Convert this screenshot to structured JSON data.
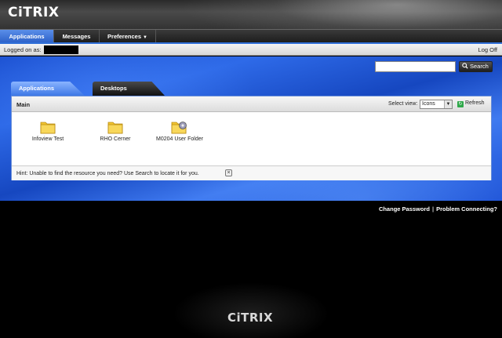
{
  "brand": {
    "logo_text": "CiTRIX"
  },
  "nav": {
    "tabs": [
      {
        "label": "Applications"
      },
      {
        "label": "Messages"
      },
      {
        "label": "Preferences"
      }
    ]
  },
  "session": {
    "logged_on_label": "Logged on as:",
    "logoff_label": "Log Off"
  },
  "search": {
    "placeholder": "",
    "button_label": "Search"
  },
  "content_tabs": {
    "applications": "Applications",
    "desktops": "Desktops"
  },
  "panel": {
    "title": "Main",
    "select_view_label": "Select view:",
    "select_view_value": "Icons",
    "refresh_label": "Refresh",
    "items": [
      {
        "label": "Infoview Test",
        "icon": "folder-icon"
      },
      {
        "label": "RHO Cerner",
        "icon": "folder-icon"
      },
      {
        "label": "M0204 User Folder",
        "icon": "folder-gear-icon"
      }
    ],
    "hint_text": "Hint: Unable to find the resource you need? Use Search to locate it for you."
  },
  "footer": {
    "change_password": "Change Password",
    "problem_connecting": "Problem Connecting?",
    "logo_text": "CiTRIX"
  },
  "colors": {
    "accent_blue": "#2b60c8",
    "background": "#000000",
    "folder_yellow": "#f2c531"
  }
}
